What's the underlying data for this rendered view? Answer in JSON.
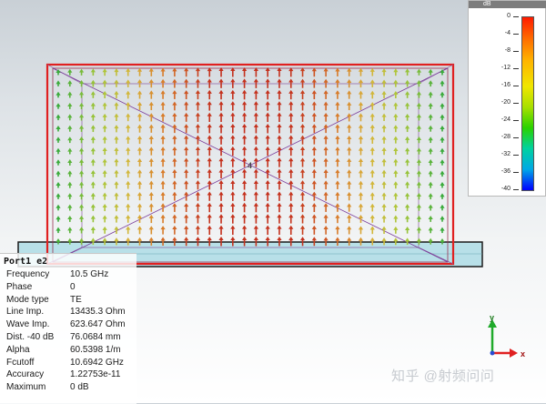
{
  "port_panel": {
    "title": "Port1 e2",
    "rows": [
      {
        "label": "Frequency",
        "value": "10.5 GHz"
      },
      {
        "label": "Phase",
        "value": "0"
      },
      {
        "label": "Mode type",
        "value": "TE"
      },
      {
        "label": "Line Imp.",
        "value": "13435.3 Ohm"
      },
      {
        "label": "Wave Imp.",
        "value": "623.647 Ohm"
      },
      {
        "label": "Dist. -40 dB",
        "value": "76.0684 mm"
      },
      {
        "label": "Alpha",
        "value": "60.5398 1/m"
      },
      {
        "label": "Fcutoff",
        "value": "10.6942 GHz"
      },
      {
        "label": "Accuracy",
        "value": "1.22753e-11"
      },
      {
        "label": "Maximum",
        "value": "0 dB"
      }
    ]
  },
  "legend": {
    "unit": "dB",
    "ticks": [
      "0",
      "-4",
      "-8",
      "-12",
      "-16",
      "-20",
      "-24",
      "-28",
      "-32",
      "-36",
      "-40"
    ],
    "range": [
      -40,
      0
    ],
    "colormap": [
      "#ff1a00",
      "#ffb400",
      "#f0e600",
      "#2ad200",
      "#00a8e6",
      "#0000ff"
    ]
  },
  "axes": {
    "x": "x",
    "y": "y"
  },
  "field_plot": {
    "arrow_direction": "up",
    "field_color_max": "#c4301c",
    "field_color_edge": "#3aaa3a",
    "port_outline_color": "#e02020",
    "substrate_color": "#b8e0e8"
  },
  "watermark": "知乎 @射频问问"
}
